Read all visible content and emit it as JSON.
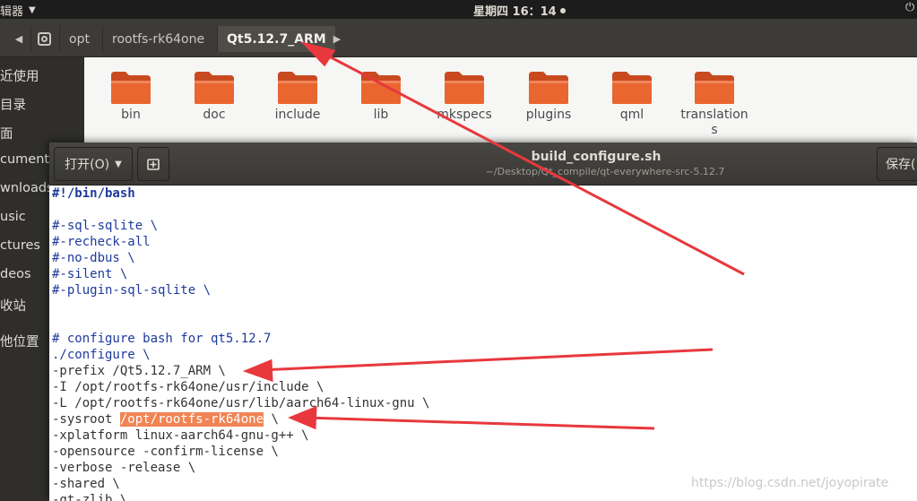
{
  "topbar": {
    "app_name": "辑器",
    "clock": "星期四 16：14",
    "power_icon": "power-icon"
  },
  "file_manager": {
    "breadcrumbs": [
      "opt",
      "rootfs-rk64one",
      "Qt5.12.7_ARM"
    ],
    "active_crumb": "Qt5.12.7_ARM",
    "sidebar": [
      "近使用",
      "目录",
      "面",
      "cuments",
      "wnloads",
      "usic",
      "ctures",
      "deos",
      "收站",
      "他位置"
    ],
    "folders": [
      "bin",
      "doc",
      "include",
      "lib",
      "mkspecs",
      "plugins",
      "qml",
      "translations"
    ],
    "folder_color": "#e0582a"
  },
  "gedit": {
    "open_label": "打开(O)",
    "save_label": "保存(",
    "title": "build_configure.sh",
    "subtitle": "~/Desktop/Qt_compile/qt-everywhere-src-5.12.7",
    "code_lines": [
      "#!/bin/bash",
      "",
      "#-sql-sqlite \\",
      "#-recheck-all",
      "#-no-dbus \\",
      "#-silent \\",
      "#-plugin-sql-sqlite \\",
      "",
      "",
      "# configure bash for qt5.12.7",
      "./configure \\",
      "-prefix /Qt5.12.7_ARM \\",
      "-I /opt/rootfs-rk64one/usr/include \\",
      "-L /opt/rootfs-rk64one/usr/lib/aarch64-linux-gnu \\",
      "-sysroot /opt/rootfs-rk64one \\",
      "-xplatform linux-aarch64-gnu-g++ \\",
      "-opensource -confirm-license \\",
      "-verbose -release \\",
      "-shared \\",
      "-qt-zlib \\"
    ],
    "highlight": "/opt/rootfs-rk64one",
    "highlight_color": "#f08454"
  },
  "annotation_color": "#e8383d",
  "watermark": "https://blog.csdn.net/joyopirate"
}
